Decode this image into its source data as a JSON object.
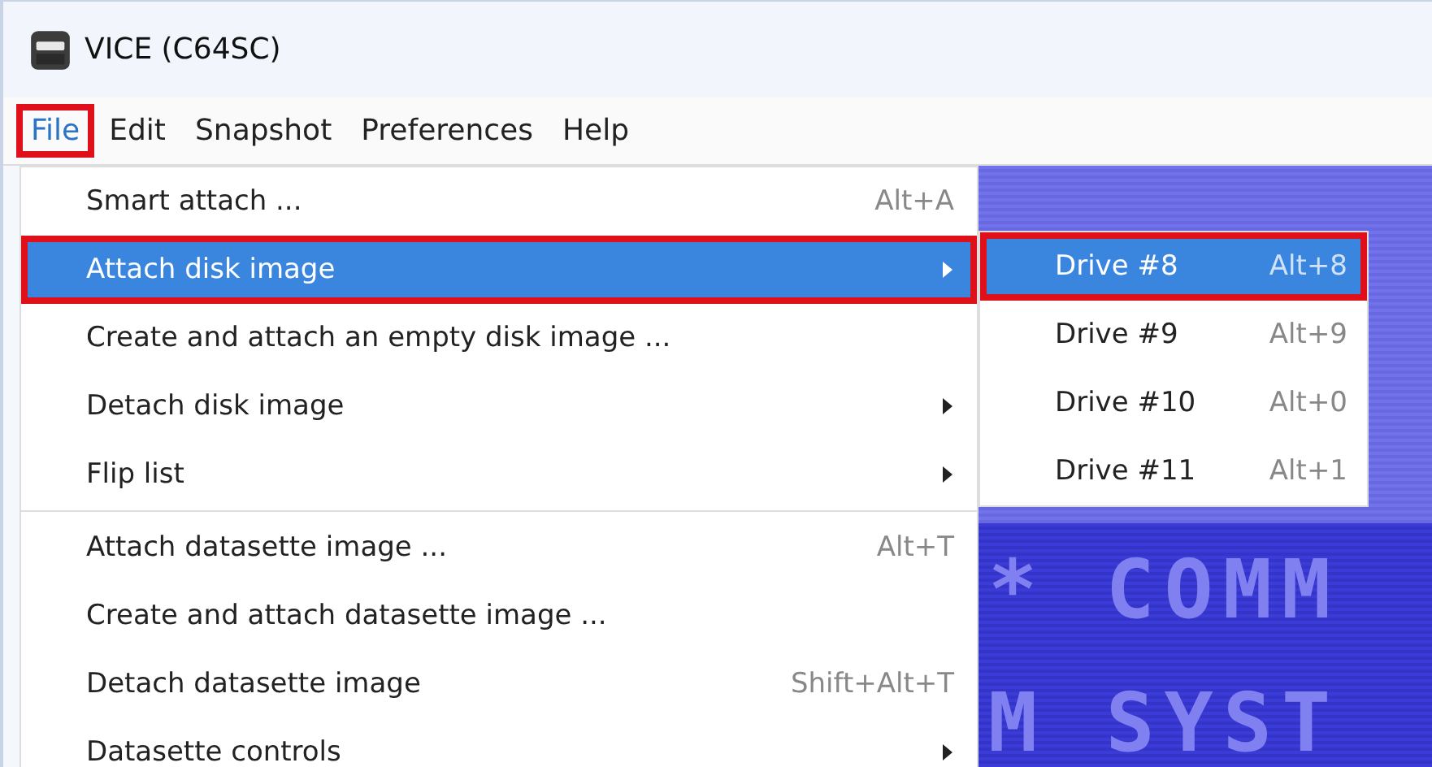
{
  "window": {
    "title": "VICE (C64SC)"
  },
  "menubar": [
    {
      "label": "File",
      "selected": true,
      "annotated": true
    },
    {
      "label": "Edit",
      "selected": false,
      "annotated": false
    },
    {
      "label": "Snapshot",
      "selected": false,
      "annotated": false
    },
    {
      "label": "Preferences",
      "selected": false,
      "annotated": false
    },
    {
      "label": "Help",
      "selected": false,
      "annotated": false
    }
  ],
  "file_menu": [
    {
      "kind": "item",
      "label": "Smart attach ...",
      "shortcut": "Alt+A",
      "submenu": false,
      "selected": false,
      "annotated": false
    },
    {
      "kind": "item",
      "label": "Attach disk image",
      "submenu": true,
      "selected": true,
      "annotated": true
    },
    {
      "kind": "item",
      "label": "Create and attach an empty disk image ...",
      "submenu": false,
      "selected": false,
      "annotated": false
    },
    {
      "kind": "item",
      "label": "Detach disk image",
      "submenu": true,
      "selected": false,
      "annotated": false
    },
    {
      "kind": "item",
      "label": "Flip list",
      "submenu": true,
      "selected": false,
      "annotated": false
    },
    {
      "kind": "separator"
    },
    {
      "kind": "item",
      "label": "Attach datasette image ...",
      "shortcut": "Alt+T",
      "submenu": false,
      "selected": false,
      "annotated": false
    },
    {
      "kind": "item",
      "label": "Create and attach datasette image ...",
      "submenu": false,
      "selected": false,
      "annotated": false
    },
    {
      "kind": "item",
      "label": "Detach datasette image",
      "shortcut": "Shift+Alt+T",
      "submenu": false,
      "selected": false,
      "annotated": false
    },
    {
      "kind": "item",
      "label": "Datasette controls",
      "submenu": true,
      "selected": false,
      "annotated": false
    }
  ],
  "submenu": [
    {
      "label": "Drive #8",
      "shortcut": "Alt+8",
      "selected": true,
      "annotated": true
    },
    {
      "label": "Drive #9",
      "shortcut": "Alt+9",
      "selected": false,
      "annotated": false
    },
    {
      "label": "Drive #10",
      "shortcut": "Alt+0",
      "selected": false,
      "annotated": false
    },
    {
      "label": "Drive #11",
      "shortcut": "Alt+1",
      "selected": false,
      "annotated": false
    }
  ],
  "emulator_screen": {
    "lines": [
      "* COMM",
      "M SYST"
    ]
  }
}
